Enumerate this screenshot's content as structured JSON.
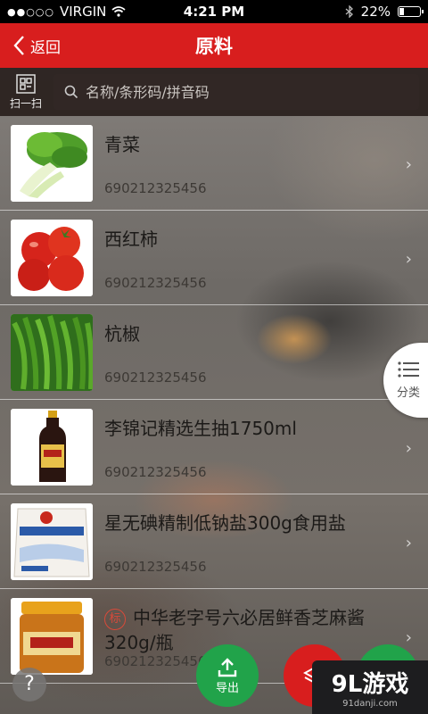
{
  "status": {
    "carrier": "VIRGIN",
    "time": "4:21 PM",
    "battery": "22%",
    "battery_level": 0.22
  },
  "nav": {
    "back_label": "返回",
    "title": "原料"
  },
  "search": {
    "scan_label": "扫一扫",
    "placeholder": "名称/条形码/拼音码"
  },
  "items": [
    {
      "name": "青菜",
      "code": "690212325456",
      "image": "bok-choy"
    },
    {
      "name": "西红柿",
      "code": "690212325456",
      "image": "tomatoes"
    },
    {
      "name": "杭椒",
      "code": "690212325456",
      "image": "green-peppers"
    },
    {
      "name": "李锦记精选生抽1750ml",
      "code": "690212325456",
      "image": "soy-sauce-bottle"
    },
    {
      "name": "星无碘精制低钠盐300g食用盐",
      "code": "690212325456",
      "image": "salt-bag"
    },
    {
      "name": "中华老字号六必居鲜香芝麻酱320g/瓶",
      "code": "690212325456",
      "image": "sesame-paste-jar",
      "tag": "标"
    }
  ],
  "category_button": {
    "label": "分类"
  },
  "fabs": {
    "export_label": "导出"
  },
  "watermark": {
    "main": "9L游戏",
    "sub": "91danji.com"
  },
  "colors": {
    "nav_red": "#d81e1e",
    "fab_green": "#21a34a"
  },
  "icons": [
    "back-chevron-icon",
    "scan-icon",
    "search-icon",
    "chevron-right-icon",
    "list-icon",
    "help-icon",
    "upload-icon",
    "layers-icon",
    "plus-icon",
    "wifi-icon",
    "bluetooth-icon",
    "battery-icon"
  ]
}
